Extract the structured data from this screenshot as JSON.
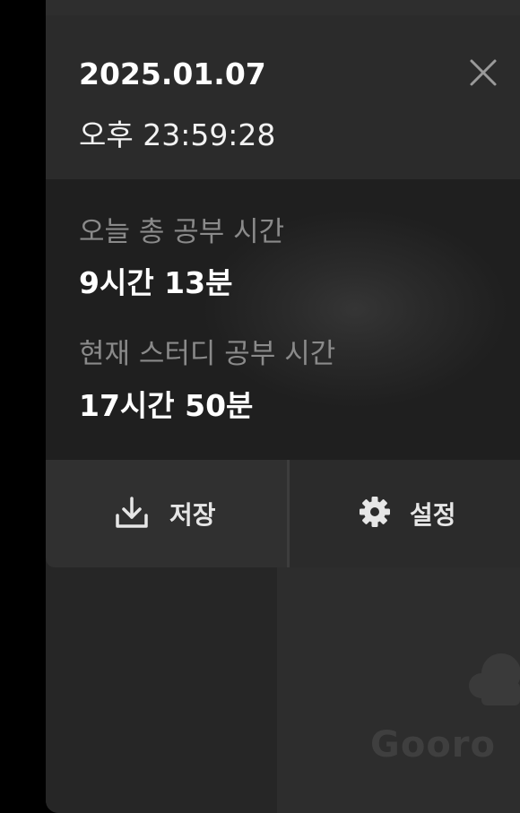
{
  "header": {
    "date": "2025.01.07",
    "time": "오후 23:59:28"
  },
  "stats": {
    "today_label": "오늘 총 공부 시간",
    "today_value": "9시간 13분",
    "current_label": "현재 스터디 공부 시간",
    "current_value": "17시간 50분"
  },
  "actions": {
    "save_label": "저장",
    "settings_label": "설정"
  },
  "watermark": {
    "text": "Gooro"
  },
  "icons": {
    "close": "close-icon",
    "download": "download-icon",
    "settings": "gear-icon",
    "logo": "cloud-logo-icon"
  },
  "colors": {
    "background": "#000000",
    "panel": "#262626",
    "text_primary": "#ffffff",
    "text_muted": "#8a8a8a"
  }
}
